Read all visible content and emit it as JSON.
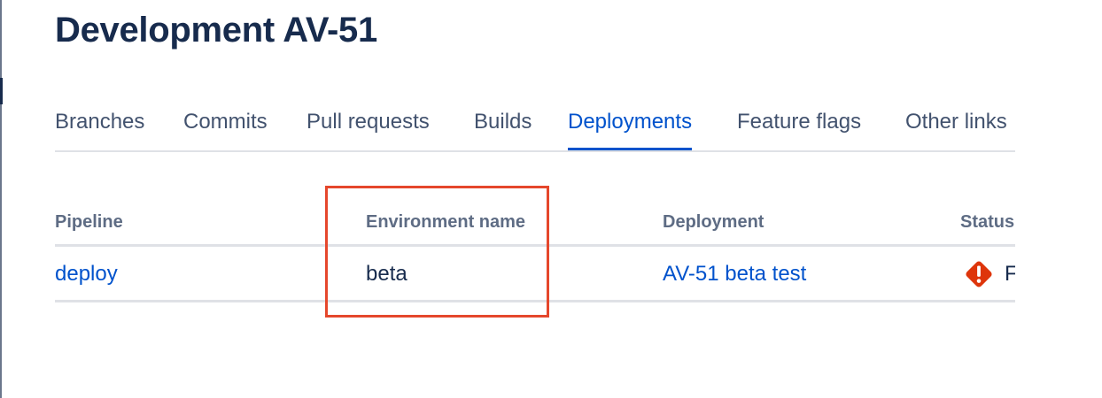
{
  "page": {
    "title": "Development AV-51"
  },
  "tabs": [
    {
      "label": "Branches",
      "active": false
    },
    {
      "label": "Commits",
      "active": false
    },
    {
      "label": "Pull requests",
      "active": false
    },
    {
      "label": "Builds",
      "active": false
    },
    {
      "label": "Deployments",
      "active": true
    },
    {
      "label": "Feature flags",
      "active": false
    },
    {
      "label": "Other links",
      "active": false
    }
  ],
  "table": {
    "headers": {
      "pipeline": "Pipeline",
      "environment": "Environment name",
      "deployment": "Deployment",
      "status": "Status"
    },
    "rows": [
      {
        "pipeline": "deploy",
        "environment": "beta",
        "deployment": "AV-51 beta test",
        "status_icon": "error-icon",
        "status_text": "F"
      }
    ]
  },
  "colors": {
    "title": "#172b4d",
    "accent": "#0052cc",
    "muted": "#5e6c84",
    "divider": "#dfe1e6",
    "error": "#de350b",
    "highlight": "#e5472c"
  }
}
